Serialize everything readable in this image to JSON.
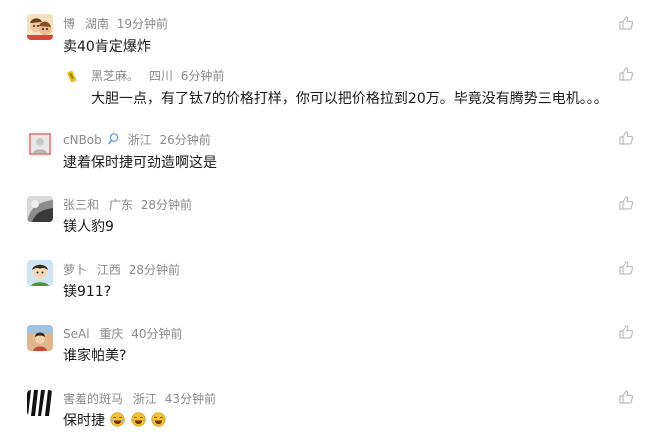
{
  "comments": [
    {
      "name": "博",
      "location": "湖南",
      "time": "19分钟前",
      "text": "卖40肯定爆炸"
    },
    {
      "name": "黑芝麻。",
      "location": "四川",
      "time": "6分钟前",
      "text": "大胆一点，有了钛7的价格打样，你可以把价格拉到20万。毕竟没有腾势三电机。。。"
    },
    {
      "name": "cNBob",
      "location": "浙江",
      "time": "26分钟前",
      "text": "逮着保时捷可劲造啊这是"
    },
    {
      "name": "张三和",
      "location": "广东",
      "time": "28分钟前",
      "text": "镁人豹9"
    },
    {
      "name": "萝卜",
      "location": "江西",
      "time": "28分钟前",
      "text": "镁911?"
    },
    {
      "name": "SeAl",
      "location": "重庆",
      "time": "40分钟前",
      "text": "谁家帕美?"
    },
    {
      "name": "害羞的斑马",
      "location": "浙江",
      "time": "43分钟前",
      "text": "保时捷"
    }
  ],
  "icons": {
    "like": "thumbs-up-icon",
    "emoji": "laughing-tears-emoji-icon",
    "medal": "badge-icon"
  },
  "colors": {
    "meta": "#8a8a8a",
    "text": "#1a1a1a",
    "like": "#bbbbbb"
  }
}
